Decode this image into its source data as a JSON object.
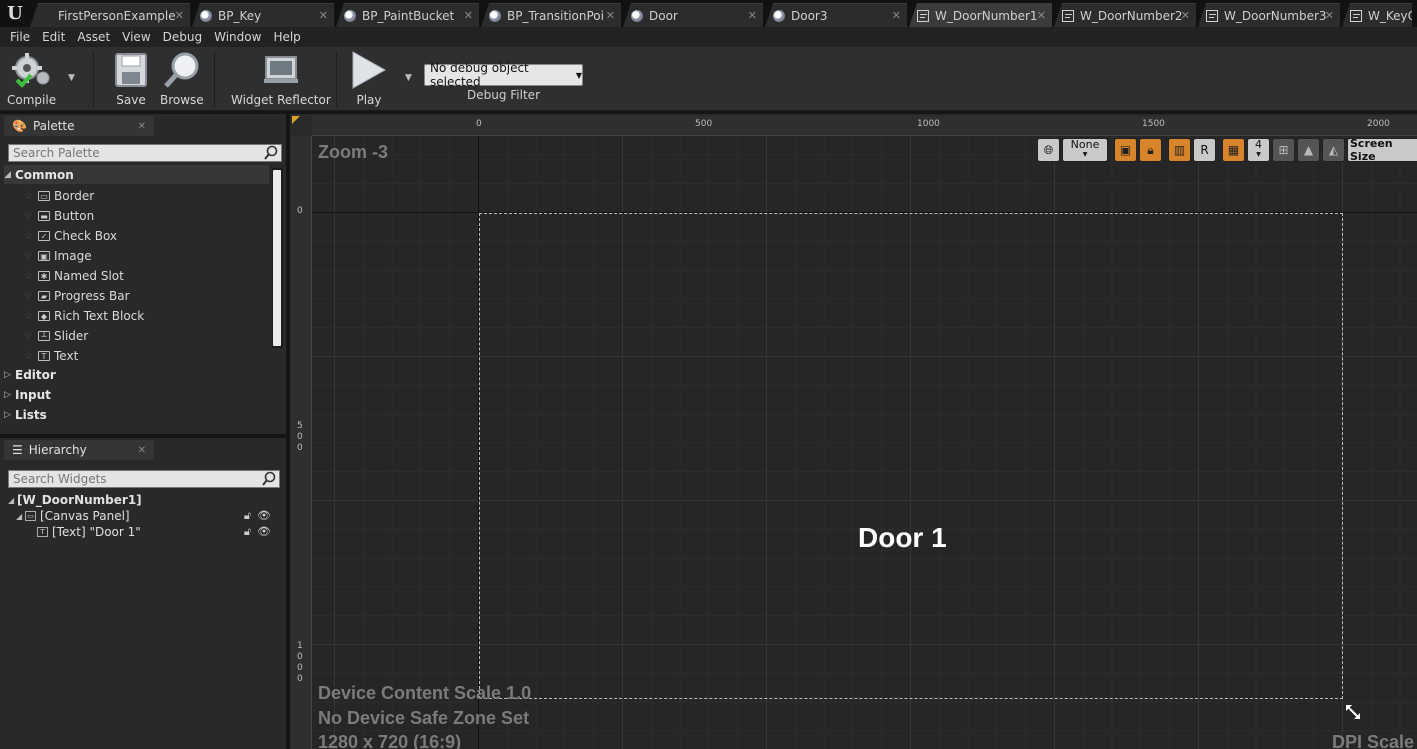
{
  "tabs": [
    {
      "label": "FirstPersonExample",
      "icon": "none",
      "active": false
    },
    {
      "label": "BP_Key",
      "icon": "blueprint-icon",
      "active": false
    },
    {
      "label": "BP_PaintBucket",
      "icon": "blueprint-icon",
      "active": false
    },
    {
      "label": "BP_TransitionPoi",
      "icon": "blueprint-icon",
      "active": false
    },
    {
      "label": "Door",
      "icon": "blueprint-icon",
      "active": false
    },
    {
      "label": "Door3",
      "icon": "blueprint-icon",
      "active": false
    },
    {
      "label": "W_DoorNumber1",
      "icon": "widget-blueprint-icon",
      "active": true
    },
    {
      "label": "W_DoorNumber2",
      "icon": "widget-blueprint-icon",
      "active": false
    },
    {
      "label": "W_DoorNumber3",
      "icon": "widget-blueprint-icon",
      "active": false
    },
    {
      "label": "W_KeyO",
      "icon": "widget-blueprint-icon",
      "active": false
    }
  ],
  "menu": [
    "File",
    "Edit",
    "Asset",
    "View",
    "Debug",
    "Window",
    "Help"
  ],
  "toolbar": {
    "compile": "Compile",
    "save": "Save",
    "browse": "Browse",
    "widget_reflector": "Widget Reflector",
    "play": "Play",
    "debug_object": "No debug object selected",
    "debug_filter": "Debug Filter"
  },
  "palette": {
    "title": "Palette",
    "search_placeholder": "Search Palette",
    "common_label": "Common",
    "common_items": [
      {
        "label": "Border",
        "glyph": "▭"
      },
      {
        "label": "Button",
        "glyph": "▬"
      },
      {
        "label": "Check Box",
        "glyph": "✓"
      },
      {
        "label": "Image",
        "glyph": "▣"
      },
      {
        "label": "Named Slot",
        "glyph": "✱"
      },
      {
        "label": "Progress Bar",
        "glyph": "▰"
      },
      {
        "label": "Rich Text Block",
        "glyph": "◆"
      },
      {
        "label": "Slider",
        "glyph": "┴"
      },
      {
        "label": "Text",
        "glyph": "T"
      }
    ],
    "categories": [
      "Editor",
      "Input",
      "Lists"
    ]
  },
  "hierarchy": {
    "title": "Hierarchy",
    "search_placeholder": "Search Widgets",
    "root": "[W_DoorNumber1]",
    "canvas": "[Canvas Panel]",
    "text": "[Text] \"Door 1\""
  },
  "designer": {
    "zoom": "Zoom -3",
    "ruler_top": [
      "0",
      "500",
      "1000",
      "1500",
      "2000"
    ],
    "ruler_left": [
      "0",
      "5\n0\n0",
      "1\n0\n0\n0"
    ],
    "widget_text": "Door 1",
    "device_scale": "Device Content Scale 1.0",
    "safe_zone": "No Device Safe Zone Set",
    "resolution": "1280 x 720 (16:9)",
    "dpi": "DPI Scale",
    "toolbar": {
      "none_label": "None",
      "r_label": "R",
      "grid_value": "4",
      "screen_size": "Screen Size"
    }
  },
  "colors": {
    "accent_orange": "#d8842a",
    "ruler_corner": "#d9a027"
  }
}
